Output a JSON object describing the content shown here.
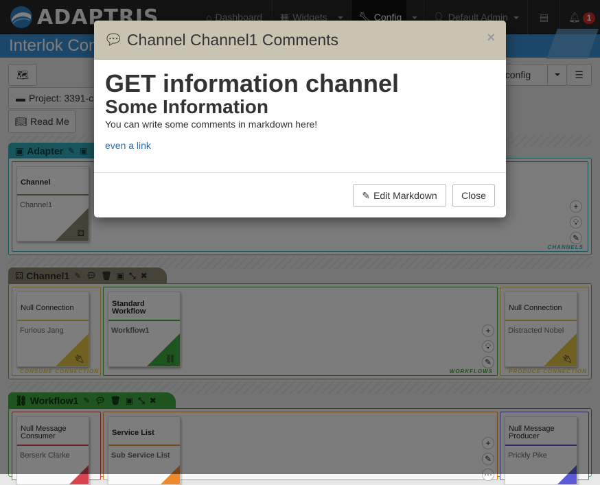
{
  "navbar": {
    "brand": "ADAPTRIS",
    "items": [
      {
        "label": "Dashboard"
      },
      {
        "label": "Widgets"
      },
      {
        "label": "Config"
      },
      {
        "label": "Default Admin"
      }
    ],
    "notification_count": "1"
  },
  "page": {
    "title": "Interlok Con"
  },
  "toolbar": {
    "project_label": "Project: 3391-c",
    "readme_label": "Read Me",
    "config_dropdown_label": "y config"
  },
  "adapter": {
    "tab_label": "Adapter",
    "zone_caption": "CHANNELS",
    "channel_card": {
      "title": "Channel",
      "name": "Channel1"
    }
  },
  "channel": {
    "tab_label": "Channel1",
    "consume": {
      "title": "Null Connection",
      "name": "Furious Jang",
      "caption": "CONSUME CONNECTION"
    },
    "workflow": {
      "title": "Standard Workflow",
      "name": "Workflow1",
      "caption": "WORKFLOWS"
    },
    "produce": {
      "title": "Null Connection",
      "name": "Distracted Nobel",
      "caption": "PRODUCE CONNECTION"
    }
  },
  "workflow": {
    "tab_label": "Workflow1",
    "consumer": {
      "title": "Null Message Consumer",
      "name": "Berserk Clarke"
    },
    "service": {
      "title": "Service List",
      "name": "Sub Service List"
    },
    "producer": {
      "title": "Null Message Producer",
      "name": "Prickly Pike"
    }
  },
  "modal": {
    "title": "Channel Channel1 Comments",
    "close_symbol": "×",
    "h1": "GET information channel",
    "h2": "Some Information",
    "paragraph": "You can write some comments in markdown here!",
    "link": "even a link",
    "edit_button": "Edit Markdown",
    "close_button": "Close"
  },
  "colors": {
    "adapter_accent": "#30a9b8",
    "channel_accent": "#8a8670",
    "workflow_accent": "#3fa63f",
    "connection_accent": "#e0c244",
    "consumer_accent": "#d9434f",
    "service_accent": "#ef8a2c",
    "producer_accent": "#5a5ad6"
  }
}
